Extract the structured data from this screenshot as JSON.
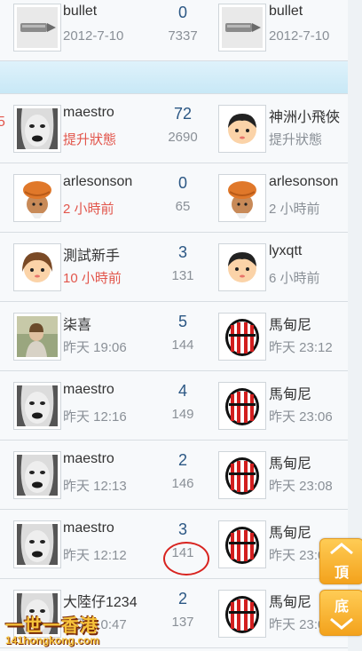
{
  "rows": [
    {
      "left_name": "bullet",
      "left_sub": "2012-7-10",
      "left_sub_red": false,
      "replies": "0",
      "views": "7337",
      "right_name": "bullet",
      "right_sub": "2012-7-10",
      "left_avatar": "bullet-icon",
      "right_avatar": "bullet-icon"
    },
    {
      "left_name": "maestro",
      "left_sub": "提升狀態",
      "left_sub_red": true,
      "replies": "72",
      "views": "2690",
      "right_name": "神洲小飛俠",
      "right_sub": "提升狀態",
      "left_avatar": "face-photo",
      "right_avatar": "cartoon-boy"
    },
    {
      "left_name": "arlesonson",
      "left_sub": "2 小時前",
      "left_sub_red": true,
      "replies": "0",
      "views": "65",
      "right_name": "arlesonson",
      "right_sub": "2 小時前",
      "left_avatar": "turban-cartoon",
      "right_avatar": "turban-cartoon"
    },
    {
      "left_name": "測試新手",
      "left_sub": "10 小時前",
      "left_sub_red": true,
      "replies": "3",
      "views": "131",
      "right_name": "lyxqtt",
      "right_sub": "6 小時前",
      "left_avatar": "cartoon-girl",
      "right_avatar": "cartoon-boy"
    },
    {
      "left_name": "柒喜",
      "left_sub": "昨天 19:06",
      "left_sub_red": false,
      "replies": "5",
      "views": "144",
      "right_name": "馬甸尼",
      "right_sub": "昨天 23:12",
      "left_avatar": "photo-girl",
      "right_avatar": "ac-milan-logo"
    },
    {
      "left_name": "maestro",
      "left_sub": "昨天 12:16",
      "left_sub_red": false,
      "replies": "4",
      "views": "149",
      "right_name": "馬甸尼",
      "right_sub": "昨天 23:06",
      "left_avatar": "face-photo",
      "right_avatar": "ac-milan-logo"
    },
    {
      "left_name": "maestro",
      "left_sub": "昨天 12:13",
      "left_sub_red": false,
      "replies": "2",
      "views": "146",
      "right_name": "馬甸尼",
      "right_sub": "昨天 23:08",
      "left_avatar": "face-photo",
      "right_avatar": "ac-milan-logo"
    },
    {
      "left_name": "maestro",
      "left_sub": "昨天 12:12",
      "left_sub_red": false,
      "replies": "3",
      "views": "141",
      "right_name": "馬甸尼",
      "right_sub": "昨天 23:0",
      "left_avatar": "face-photo",
      "right_avatar": "ac-milan-logo"
    },
    {
      "left_name": "大陸仔1234",
      "left_sub": "昨天 10:47",
      "left_sub_red": false,
      "replies": "2",
      "views": "137",
      "right_name": "馬甸尼",
      "right_sub": "昨天 23:05",
      "left_avatar": "face-photo",
      "right_avatar": "ac-milan-logo"
    }
  ],
  "banner_after_row": 0,
  "left_marker": "5",
  "nav": {
    "top_label": "頂",
    "bottom_label": "底"
  },
  "logo": {
    "title": "一世一香港",
    "url": "141hongkong.com"
  },
  "colors": {
    "accent_red": "#e2554b",
    "number_blue": "#2b5784",
    "highlight_circle": "#d8231f",
    "nav_orange": "#f3a21c"
  }
}
